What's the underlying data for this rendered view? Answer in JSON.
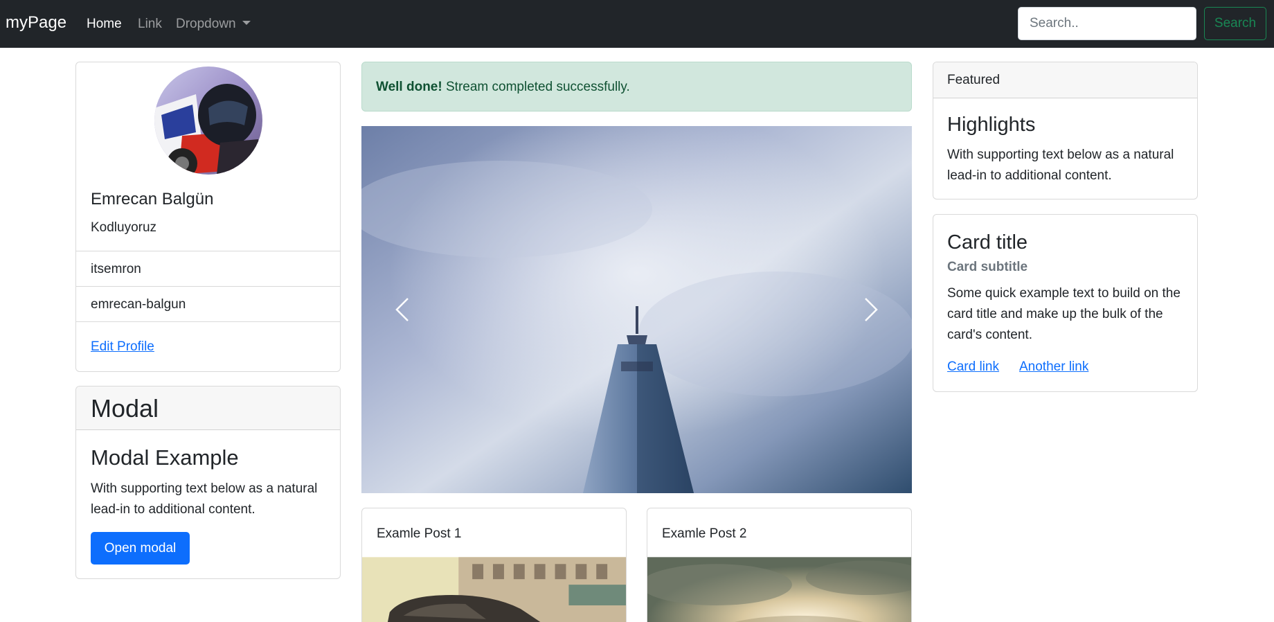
{
  "navbar": {
    "brand": "myPage",
    "links": [
      {
        "label": "Home",
        "active": true
      },
      {
        "label": "Link",
        "active": false
      },
      {
        "label": "Dropdown",
        "active": false
      }
    ],
    "search": {
      "placeholder": "Search..",
      "value": "",
      "button_label": "Search"
    }
  },
  "profile": {
    "name": "Emrecan Balgün",
    "subtitle": "Kodluyoruz",
    "items": [
      "itsemron",
      "emrecan-balgun"
    ],
    "edit_link": "Edit Profile"
  },
  "modal_card": {
    "header": "Modal",
    "title": "Modal Example",
    "text": "With supporting text below as a natural lead-in to additional content.",
    "button_label": "Open modal"
  },
  "alert": {
    "strong": "Well done!",
    "message": "Stream completed successfully."
  },
  "posts": [
    {
      "title": "Examle Post 1"
    },
    {
      "title": "Examle Post 2"
    }
  ],
  "featured": {
    "header": "Featured",
    "title": "Highlights",
    "text": "With supporting text below as a natural lead-in to additional content."
  },
  "info_card": {
    "title": "Card title",
    "subtitle": "Card subtitle",
    "text": "Some quick example text to build on the card title and make up the bulk of the card's content.",
    "link1": "Card link",
    "link2": "Another link"
  },
  "colors": {
    "navbar_bg": "#212529",
    "primary": "#0d6efd",
    "success": "#198754",
    "alert_bg": "#d1e7dd",
    "alert_text": "#0f5132"
  }
}
